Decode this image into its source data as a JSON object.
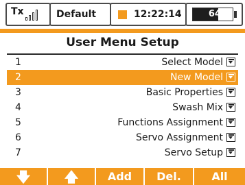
{
  "status": {
    "tx_label": "Tx",
    "model_name": "Default",
    "time": "12:22:14",
    "battery": "64%",
    "battery_level": 0.64
  },
  "title": "User Menu Setup",
  "menu": {
    "items": [
      {
        "num": "1",
        "label": "Select Model"
      },
      {
        "num": "2",
        "label": "New Model",
        "selected": true
      },
      {
        "num": "3",
        "label": "Basic Properties"
      },
      {
        "num": "4",
        "label": "Swash Mix"
      },
      {
        "num": "5",
        "label": "Functions Assignment"
      },
      {
        "num": "6",
        "label": "Servo Assignment"
      },
      {
        "num": "7",
        "label": "Servo Setup"
      }
    ]
  },
  "buttons": {
    "down": "🡇",
    "up": "🡅",
    "add": "Add",
    "del": "Del.",
    "all": "All"
  },
  "colors": {
    "accent": "#f39a1e",
    "text": "#1a1a1a"
  }
}
